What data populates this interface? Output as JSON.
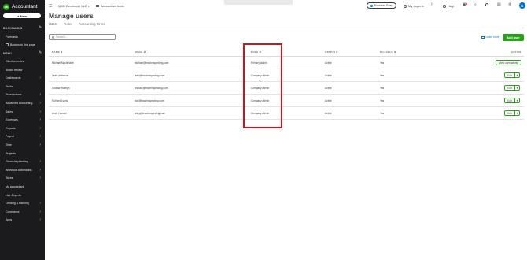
{
  "brand": {
    "name": "Accountant",
    "logo": "qb"
  },
  "new_button": "+ New",
  "sidebar": {
    "bookmarks_title": "BOOKMARKS",
    "bookmarks": [
      "Forecasts",
      "Bookmark this page"
    ],
    "menu_title": "MENU",
    "items": [
      {
        "label": "Client overview",
        "chevron": false
      },
      {
        "label": "Books review",
        "chevron": false
      },
      {
        "label": "Dashboards",
        "chevron": true
      },
      {
        "label": "Tasks",
        "chevron": false
      },
      {
        "label": "Transactions",
        "chevron": true
      },
      {
        "label": "Advanced accounting",
        "chevron": true
      },
      {
        "label": "Sales",
        "chevron": true
      },
      {
        "label": "Expenses",
        "chevron": true
      },
      {
        "label": "Reports",
        "chevron": true
      },
      {
        "label": "Payroll",
        "chevron": true
      },
      {
        "label": "Time",
        "chevron": true
      },
      {
        "label": "Projects",
        "chevron": false
      },
      {
        "label": "Financial planning",
        "chevron": true
      },
      {
        "label": "Workflow automation",
        "chevron": true
      },
      {
        "label": "Taxes",
        "chevron": true
      },
      {
        "label": "My accountant",
        "chevron": false
      },
      {
        "label": "Live Experts",
        "chevron": false
      },
      {
        "label": "Lending & banking",
        "chevron": true
      },
      {
        "label": "Commerce",
        "chevron": true
      },
      {
        "label": "Apps",
        "chevron": true
      }
    ]
  },
  "topbar": {
    "company": "QBO Developer LLC",
    "accountant_tools": "Accountant tools",
    "business_feed": "Business Feed",
    "my_experts": "My experts",
    "help": "Help",
    "avatar_initial": "R"
  },
  "page": {
    "title": "Manage users",
    "tabs": [
      "Users",
      "Roles",
      "Accounting Firms"
    ],
    "search_placeholder": "Search...",
    "learn_more": "Learn more",
    "add_user": "Add user"
  },
  "table": {
    "headers": {
      "name": "NAME",
      "email": "EMAIL",
      "role": "ROLE",
      "status": "STATUS",
      "billable": "BILLABLE",
      "action": "ACTION"
    },
    "rows": [
      {
        "name": "Michael Macfarlane",
        "email": "michael@teachinspecting.com",
        "role": "Primary admin",
        "status": "Active",
        "billable": "Yes",
        "action": "View user activity"
      },
      {
        "name": "Leah anderson",
        "email": "leah@teachinspecting.com",
        "role": "Company admin",
        "status": "Active",
        "billable": "Yes",
        "action": "Edit"
      },
      {
        "name": "Chasse Raleigh",
        "email": "chasse@teachinspecting.com",
        "role": "Company admin",
        "status": "Active",
        "billable": "Yes",
        "action": "Edit"
      },
      {
        "name": "Richard Lyons",
        "email": "rich@teachinspecting.com",
        "role": "Company admin",
        "status": "Active",
        "billable": "Yes",
        "action": "Edit"
      },
      {
        "name": "Andy Hansen",
        "email": "andy@teachinspecting.com",
        "role": "Company admin",
        "status": "Active",
        "billable": "Yes",
        "action": "Edit"
      }
    ]
  },
  "colors": {
    "sidebar_bg": "#1b1b1d",
    "accent_green": "#2ca01c",
    "highlight_red": "#d0121b",
    "link_blue": "#0077c5"
  }
}
